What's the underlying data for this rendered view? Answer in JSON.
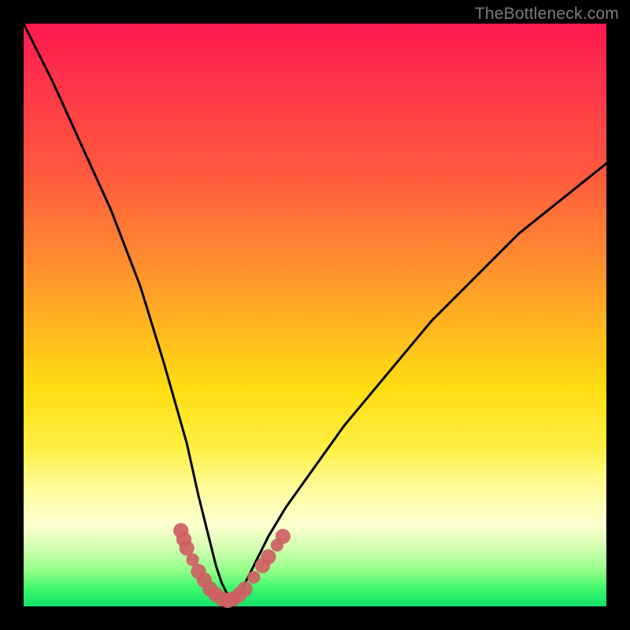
{
  "watermark": "TheBottleneck.com",
  "colors": {
    "page_bg": "#000000",
    "gradient_top": "#ff1850",
    "gradient_mid1": "#ff8a2f",
    "gradient_mid2": "#ffde12",
    "gradient_mid3": "#fffc9e",
    "gradient_bottom": "#13e26a",
    "curve": "#000000",
    "marker": "#ce6064",
    "watermark_text": "#7c7c7c"
  },
  "chart_data": {
    "type": "line",
    "title": "",
    "xlabel": "",
    "ylabel": "",
    "xlim": [
      0,
      100
    ],
    "ylim": [
      0,
      100
    ],
    "grid": false,
    "legend": false,
    "note": "Values estimated from pixel positions; no numeric ticks are visible on the original.",
    "series": [
      {
        "name": "main-curve",
        "x": [
          0,
          5,
          10,
          15,
          20,
          24,
          28,
          30,
          32,
          33,
          34,
          35,
          36,
          37,
          38,
          40,
          42,
          45,
          50,
          55,
          60,
          65,
          70,
          75,
          80,
          85,
          90,
          95,
          100
        ],
        "y": [
          100,
          90,
          79,
          68,
          55,
          42,
          28,
          19,
          11,
          7,
          4,
          2,
          1,
          2,
          4,
          8,
          12,
          17,
          24,
          31,
          37,
          43,
          49,
          54,
          59,
          64,
          68,
          72,
          76
        ]
      }
    ],
    "markers": [
      {
        "x": 27.0,
        "y": 13.0,
        "r": 1.3,
        "label": "left-upper-cluster"
      },
      {
        "x": 27.5,
        "y": 11.5,
        "r": 1.3,
        "label": "left-upper-cluster"
      },
      {
        "x": 28.0,
        "y": 10.0,
        "r": 1.3,
        "label": "left-upper-cluster"
      },
      {
        "x": 29.0,
        "y": 8.0,
        "r": 1.1,
        "label": "left-mid"
      },
      {
        "x": 30.0,
        "y": 6.0,
        "r": 1.3,
        "label": "left-mid"
      },
      {
        "x": 31.0,
        "y": 4.5,
        "r": 1.3,
        "label": "left-lower"
      },
      {
        "x": 32.0,
        "y": 3.0,
        "r": 1.3,
        "label": "bottom"
      },
      {
        "x": 33.0,
        "y": 2.0,
        "r": 1.3,
        "label": "bottom"
      },
      {
        "x": 34.0,
        "y": 1.3,
        "r": 1.3,
        "label": "bottom"
      },
      {
        "x": 35.0,
        "y": 1.0,
        "r": 1.3,
        "label": "bottom"
      },
      {
        "x": 36.0,
        "y": 1.3,
        "r": 1.3,
        "label": "bottom"
      },
      {
        "x": 37.0,
        "y": 2.0,
        "r": 1.3,
        "label": "bottom"
      },
      {
        "x": 38.0,
        "y": 3.0,
        "r": 1.3,
        "label": "bottom"
      },
      {
        "x": 39.5,
        "y": 5.0,
        "r": 1.1,
        "label": "right-lower"
      },
      {
        "x": 41.0,
        "y": 7.0,
        "r": 1.3,
        "label": "right-mid"
      },
      {
        "x": 42.0,
        "y": 8.5,
        "r": 1.3,
        "label": "right-mid"
      },
      {
        "x": 43.5,
        "y": 10.5,
        "r": 1.1,
        "label": "right-upper"
      },
      {
        "x": 44.5,
        "y": 12.0,
        "r": 1.3,
        "label": "right-upper"
      }
    ]
  }
}
